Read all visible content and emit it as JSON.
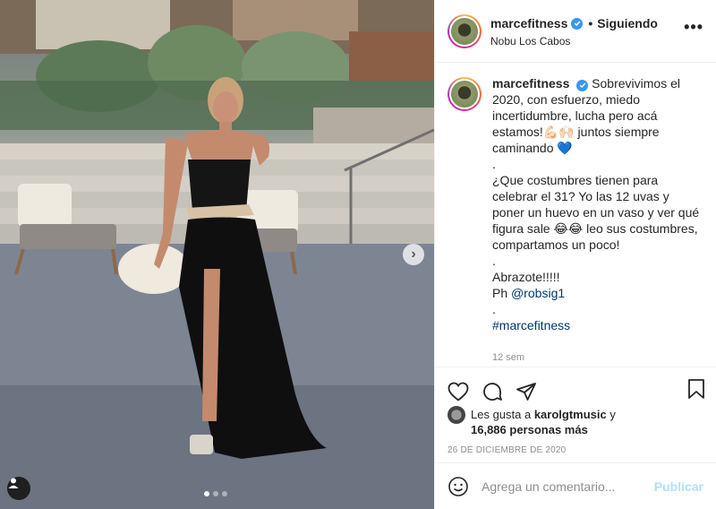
{
  "post": {
    "username": "marcefitness",
    "separator": "•",
    "follow_status": "Siguiendo",
    "location": "Nobu Los Cabos",
    "more_label": "•••"
  },
  "caption": {
    "username": "marcefitness",
    "lines": [
      "Sobrevivimos el",
      "2020, con esfuerzo, miedo",
      "incertidumbre, lucha pero acá",
      "estamos!💪🏻🙌🏻 juntos siempre",
      "caminando 💙",
      ".",
      "¿Que costumbres tienen para",
      "celebrar el 31? Yo las 12 uvas y",
      "poner un huevo en un vaso y ver qué",
      "figura sale 😂😂 leo sus costumbres,",
      "compartamos un poco!",
      ".",
      "Abrazote!!!!!",
      "Ph ",
      ".",
      "#marcefitness"
    ],
    "mention": "@robsig1",
    "time_ago": "12 sem"
  },
  "likes": {
    "prefix": "Les gusta a ",
    "liker": "karolgtmusic",
    "connector": " y",
    "count_text": "16,886 personas más"
  },
  "date": "26 DE DICIEMBRE DE 2020",
  "comment": {
    "placeholder": "Agrega un comentario...",
    "publish_label": "Publicar"
  },
  "carousel": {
    "next_glyph": "›",
    "dots": 3,
    "active_dot": 0
  },
  "icons": {
    "like": "heart-icon",
    "comment": "comment-icon",
    "share": "paper-plane-icon",
    "save": "bookmark-icon",
    "emoji": "emoji-icon",
    "verified": "verified-badge-icon",
    "tagged": "user-tag-icon",
    "next": "chevron-right-icon"
  },
  "colors": {
    "verified": "#3897f0",
    "publish_disabled": "#b2dffc",
    "link": "#00376b",
    "muted": "#8e8e8e"
  }
}
